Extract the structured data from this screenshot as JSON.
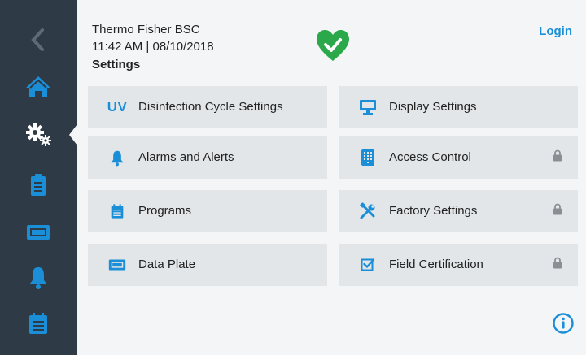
{
  "colors": {
    "accent": "#1a8fd8",
    "sidebar": "#2e3a45",
    "tile": "#e3e6e9",
    "health": "#2aa84a"
  },
  "sidebar": {
    "items": [
      {
        "name": "back",
        "icon": "chevron-left-icon"
      },
      {
        "name": "home",
        "icon": "home-icon"
      },
      {
        "name": "settings",
        "icon": "gears-icon",
        "active": true
      },
      {
        "name": "programs",
        "icon": "clipboard-icon"
      },
      {
        "name": "data-plate",
        "icon": "data-plate-icon"
      },
      {
        "name": "alarms",
        "icon": "bell-icon"
      },
      {
        "name": "calendar",
        "icon": "calendar-icon"
      }
    ]
  },
  "header": {
    "device_name": "Thermo Fisher BSC",
    "datetime": "11:42  AM | 08/10/2018",
    "title": "Settings",
    "status_icon": "heart-check-icon"
  },
  "login_label": "Login",
  "tiles": [
    {
      "label": "Disinfection Cycle Settings",
      "icon": "uv-text",
      "icon_text": "UV",
      "locked": false
    },
    {
      "label": "Display Settings",
      "icon": "monitor-icon",
      "locked": false
    },
    {
      "label": "Alarms and Alerts",
      "icon": "bell-icon",
      "locked": false
    },
    {
      "label": "Access Control",
      "icon": "keypad-icon",
      "locked": true
    },
    {
      "label": "Programs",
      "icon": "calendar-list-icon",
      "locked": false
    },
    {
      "label": "Factory Settings",
      "icon": "tools-icon",
      "locked": true
    },
    {
      "label": "Data Plate",
      "icon": "data-plate-icon",
      "locked": false
    },
    {
      "label": "Field Certification",
      "icon": "checkbox-icon",
      "locked": true
    }
  ],
  "info_icon": "info-icon"
}
